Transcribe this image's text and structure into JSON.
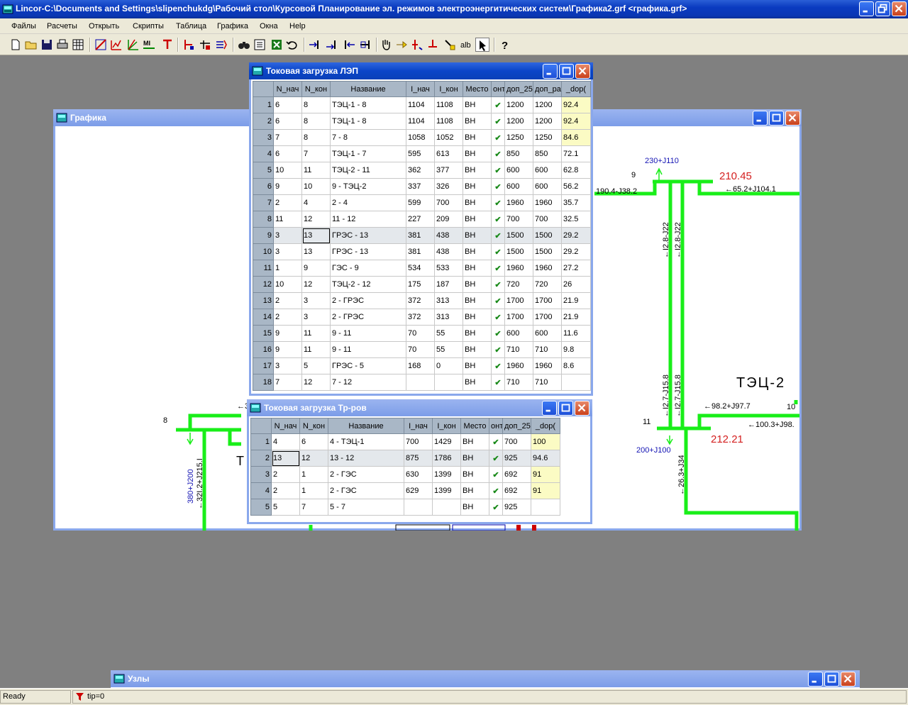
{
  "app": {
    "title": "Lincor-C:\\Documents and Settings\\slipenchukdg\\Рабочий стол\\Курсовой Планирование эл. режимов электроэнергитических систем\\Графика2.grf <графика.grf>"
  },
  "menu": [
    "Файлы",
    "Расчеты",
    "Открыть",
    "Скрипты",
    "Таблица",
    "Графика",
    "Окна",
    "Help"
  ],
  "toolbar": {
    "icons": [
      "new-file-icon",
      "open-folder-icon",
      "save-icon",
      "print-icon",
      "table-icon",
      "graph-tool-1-icon",
      "graph-tool-2-icon",
      "graph-tool-3-icon",
      "graph-tool-4-icon",
      "graph-tool-5-icon",
      "branch-tool-1-icon",
      "branch-tool-2-icon",
      "branch-tool-3-icon",
      "find-icon",
      "properties-icon",
      "excel-icon",
      "undo-icon",
      "node-tool-1-icon",
      "node-tool-2-icon",
      "node-tool-3-icon",
      "node-tool-4-icon",
      "hand-icon",
      "arrow-icon",
      "line-tool-1-icon",
      "line-tool-2-icon",
      "edit-tool-icon",
      "text-label-icon",
      "pointer-icon",
      "help-icon"
    ],
    "text_label": "alb",
    "help_glyph": "?"
  },
  "windows": {
    "graphics_title": "Графика",
    "lep_title": "Токовая загрузка ЛЭП",
    "tr_title": "Токовая загрузка Тр-ров",
    "nodes_title": "Узлы"
  },
  "lep": {
    "columns": [
      "N_нач",
      "N_кон",
      "Название",
      "I_нач",
      "I_кон",
      "Место",
      "онтр",
      "доп_25",
      "доп_рас",
      "_dop("
    ],
    "rows": [
      [
        "1",
        "6",
        "8",
        "ТЭЦ-1 - 8",
        "1104",
        "1108",
        "ВН",
        "✔",
        "1200",
        "1200",
        "92.4"
      ],
      [
        "2",
        "6",
        "8",
        "ТЭЦ-1 - 8",
        "1104",
        "1108",
        "ВН",
        "✔",
        "1200",
        "1200",
        "92.4"
      ],
      [
        "3",
        "7",
        "8",
        "7 - 8",
        "1058",
        "1052",
        "ВН",
        "✔",
        "1250",
        "1250",
        "84.6"
      ],
      [
        "4",
        "6",
        "7",
        "ТЭЦ-1 - 7",
        "595",
        "613",
        "ВН",
        "✔",
        "850",
        "850",
        "72.1"
      ],
      [
        "5",
        "10",
        "11",
        "ТЭЦ-2 - 11",
        "362",
        "377",
        "ВН",
        "✔",
        "600",
        "600",
        "62.8"
      ],
      [
        "6",
        "9",
        "10",
        "9 - ТЭЦ-2",
        "337",
        "326",
        "ВН",
        "✔",
        "600",
        "600",
        "56.2"
      ],
      [
        "7",
        "2",
        "4",
        "2 - 4",
        "599",
        "700",
        "ВН",
        "✔",
        "1960",
        "1960",
        "35.7"
      ],
      [
        "8",
        "11",
        "12",
        "11 - 12",
        "227",
        "209",
        "ВН",
        "✔",
        "700",
        "700",
        "32.5"
      ],
      [
        "9",
        "3",
        "13",
        "ГРЭС - 13",
        "381",
        "438",
        "ВН",
        "✔",
        "1500",
        "1500",
        "29.2"
      ],
      [
        "10",
        "3",
        "13",
        "ГРЭС - 13",
        "381",
        "438",
        "ВН",
        "✔",
        "1500",
        "1500",
        "29.2"
      ],
      [
        "11",
        "1",
        "9",
        "ГЭС - 9",
        "534",
        "533",
        "ВН",
        "✔",
        "1960",
        "1960",
        "27.2"
      ],
      [
        "12",
        "10",
        "12",
        "ТЭЦ-2 - 12",
        "175",
        "187",
        "ВН",
        "✔",
        "720",
        "720",
        "26"
      ],
      [
        "13",
        "2",
        "3",
        "2 - ГРЭС",
        "372",
        "313",
        "ВН",
        "✔",
        "1700",
        "1700",
        "21.9"
      ],
      [
        "14",
        "2",
        "3",
        "2 - ГРЭС",
        "372",
        "313",
        "ВН",
        "✔",
        "1700",
        "1700",
        "21.9"
      ],
      [
        "15",
        "9",
        "11",
        "9 - 11",
        "70",
        "55",
        "ВН",
        "✔",
        "600",
        "600",
        "11.6"
      ],
      [
        "16",
        "9",
        "11",
        "9 - 11",
        "70",
        "55",
        "ВН",
        "✔",
        "710",
        "710",
        "9.8"
      ],
      [
        "17",
        "3",
        "5",
        "ГРЭС - 5",
        "168",
        "0",
        "ВН",
        "✔",
        "1960",
        "1960",
        "8.6"
      ],
      [
        "18",
        "7",
        "12",
        "7 - 12",
        "",
        "",
        "ВН",
        "✔",
        "710",
        "710",
        ""
      ]
    ]
  },
  "tr": {
    "columns": [
      "N_нач",
      "N_кон",
      "Название",
      "I_нач",
      "I_кон",
      "Место",
      "онтр",
      "доп_25",
      "_dop("
    ],
    "rows": [
      [
        "1",
        "4",
        "6",
        "4 - ТЭЦ-1",
        "700",
        "1429",
        "ВН",
        "✔",
        "700",
        "100"
      ],
      [
        "2",
        "13",
        "12",
        "13 - 12",
        "875",
        "1786",
        "ВН",
        "✔",
        "925",
        "94.6"
      ],
      [
        "3",
        "2",
        "1",
        "2 - ГЭС",
        "630",
        "1399",
        "ВН",
        "✔",
        "692",
        "91"
      ],
      [
        "4",
        "2",
        "1",
        "2 - ГЭС",
        "629",
        "1399",
        "ВН",
        "✔",
        "692",
        "91"
      ],
      [
        "5",
        "5",
        "7",
        "5 - 7",
        "",
        "",
        "ВН",
        "✔",
        "925",
        ""
      ]
    ]
  },
  "diagram": {
    "labels": {
      "n9": "9",
      "v9": "210.45",
      "load9": "230+J110",
      "flow_left": "190.4-J38.2",
      "flow_right": "←65.2+J104.1",
      "fv1": "←I2.8-J22",
      "fv2": "←I2.8-J22",
      "station": "ТЭЦ-2",
      "fv3": "←I2.7-J15.8",
      "fv4": "←I2.7-J15.8",
      "f11a": "←98.2+J97.7",
      "n10": "10",
      "n11": "11",
      "f11b": "←100.3+J98.",
      "v11": "212.21",
      "load11": "200+J100",
      "f11c": "←26.3+J34",
      "n8": "8",
      "f8": "←3",
      "lt": "Т",
      "fv5": "380+J200",
      "fv6": "←32I.2+J215.I"
    },
    "colors": {
      "line": "#19ee19",
      "voltage": "#d42020",
      "load": "#1414b4"
    }
  },
  "status": {
    "ready": "Ready",
    "tip": "tip=0"
  }
}
